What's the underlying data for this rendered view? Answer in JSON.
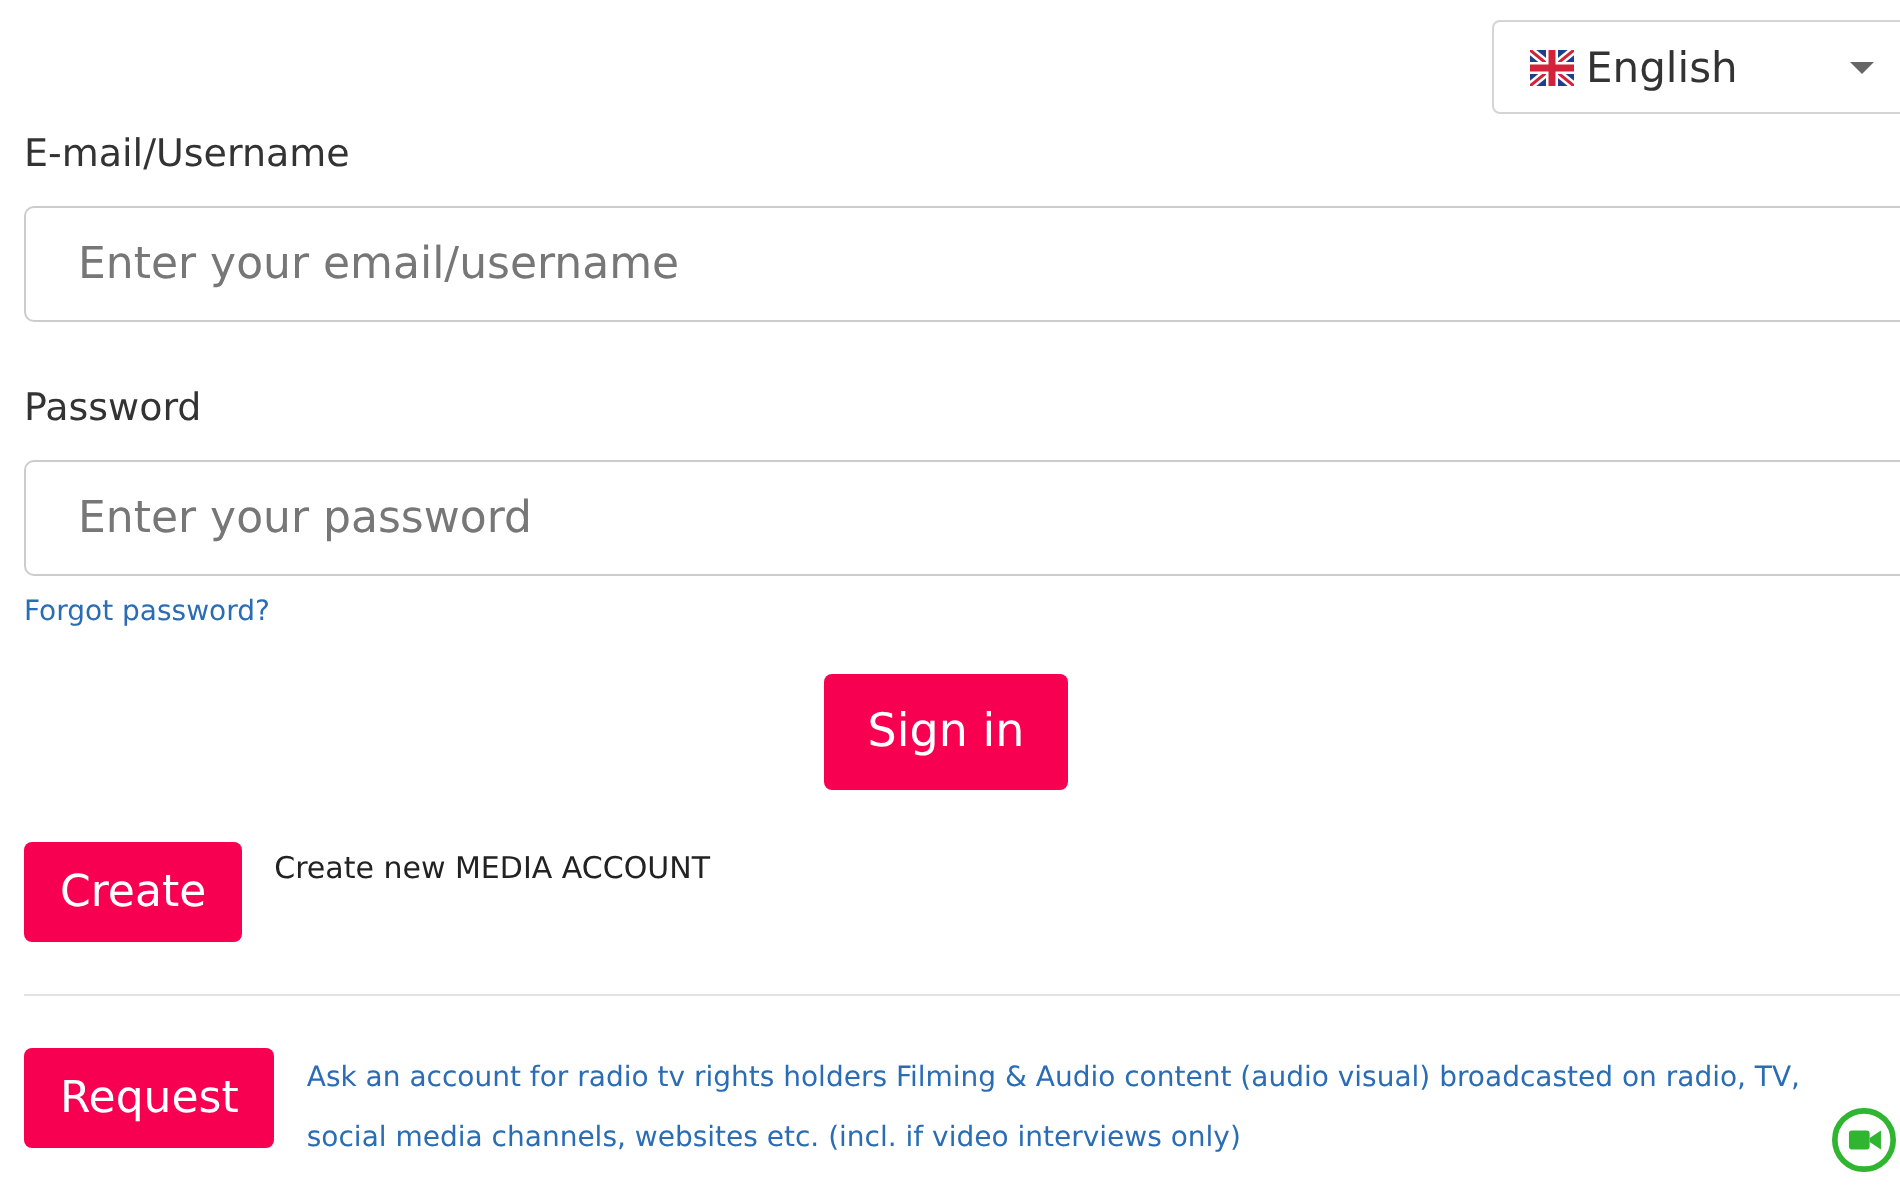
{
  "language_select": {
    "value": "English"
  },
  "fields": [
    {
      "label": "E-mail/Username",
      "placeholder": "Enter your email/username"
    },
    {
      "label": "Password",
      "placeholder": "Enter your password"
    }
  ],
  "forgot_link": "Forgot password?",
  "sign_in_button": "Sign in",
  "create": {
    "button": "Create",
    "text": "Create new MEDIA ACCOUNT"
  },
  "request": {
    "button": "Request",
    "text": "Ask an account for radio tv rights holders Filming & Audio content (audio visual) broadcasted on radio, TV, social media channels, websites etc. (incl. if video interviews only)"
  }
}
